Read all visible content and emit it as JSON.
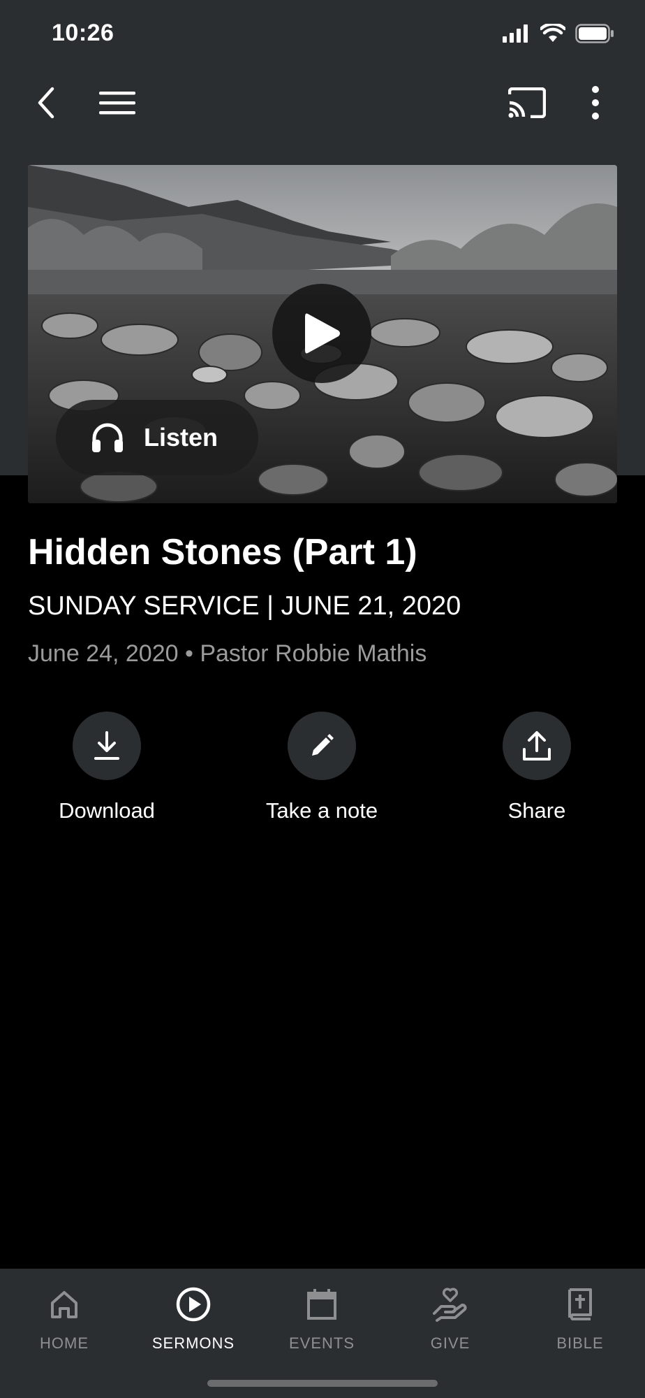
{
  "status_bar": {
    "time": "10:26"
  },
  "app_bar": {
    "back_icon": "chevron-left-icon",
    "menu_icon": "hamburger-menu-icon",
    "cast_icon": "cast-icon",
    "more_icon": "more-vertical-icon"
  },
  "hero": {
    "play_icon": "play-icon",
    "listen_label": "Listen",
    "listen_icon": "headphones-icon"
  },
  "sermon": {
    "title": "Hidden Stones (Part 1)",
    "subtitle": "SUNDAY SERVICE | JUNE 21, 2020",
    "meta": "June 24, 2020 • Pastor Robbie Mathis"
  },
  "actions": [
    {
      "label": "Download",
      "icon": "download-icon"
    },
    {
      "label": "Take a note",
      "icon": "pencil-icon"
    },
    {
      "label": "Share",
      "icon": "share-icon"
    }
  ],
  "nav": {
    "active": "SERMONS",
    "items": [
      {
        "label": "HOME",
        "icon": "home-icon"
      },
      {
        "label": "SERMONS",
        "icon": "play-circle-icon"
      },
      {
        "label": "EVENTS",
        "icon": "calendar-icon"
      },
      {
        "label": "GIVE",
        "icon": "give-hand-heart-icon"
      },
      {
        "label": "BIBLE",
        "icon": "bible-icon"
      }
    ]
  },
  "colors": {
    "surface": "#2b2e30",
    "background": "#000000",
    "text_primary": "#ffffff",
    "text_secondary": "#9b9b9b",
    "nav_inactive": "#8d8f90"
  }
}
